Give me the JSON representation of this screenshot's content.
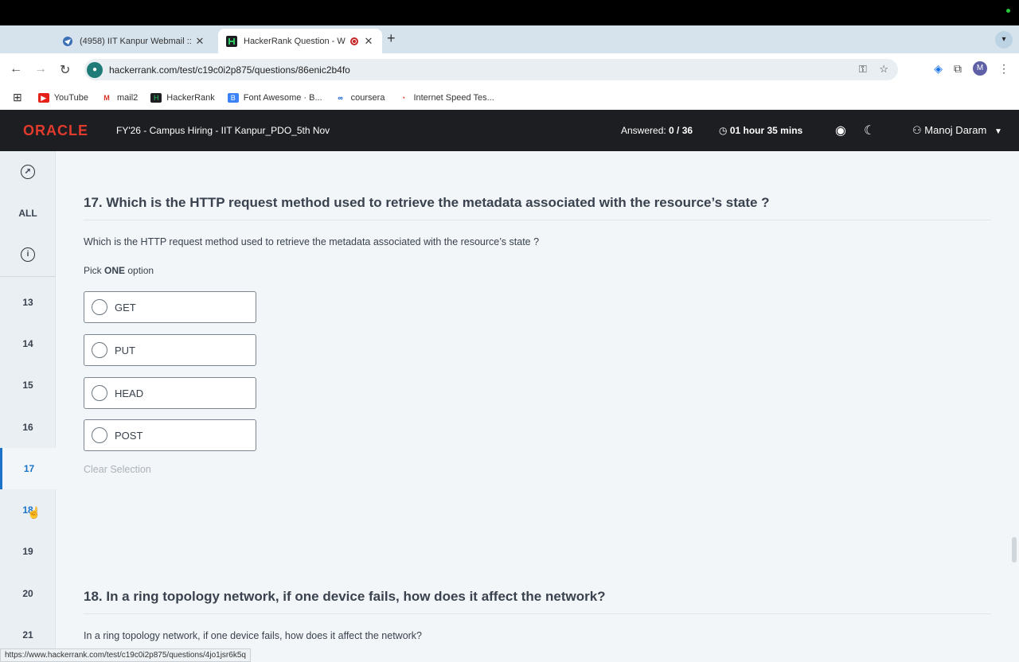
{
  "browser": {
    "tabs": [
      {
        "title": "(4958) IIT Kanpur Webmail ::",
        "active": false
      },
      {
        "title": "HackerRank Question - W",
        "active": true
      }
    ],
    "url": "hackerrank.com/test/c19c0i2p875/questions/86enic2b4fo",
    "status_url": "https://www.hackerrank.com/test/c19c0i2p875/questions/4jo1jsr6k5q",
    "profile_initial": "M",
    "bookmarks": [
      "YouTube",
      "mail2",
      "HackerRank",
      "Font Awesome · B...",
      "coursera",
      "Internet Speed Tes..."
    ]
  },
  "header": {
    "logo": "ORACLE",
    "test_title": "FY'26 - Campus Hiring - IIT Kanpur_PDO_5th Nov",
    "answered_label": "Answered:",
    "answered_value": "0 / 36",
    "timer": "01 hour 35 mins",
    "user": "Manoj Daram"
  },
  "rail": {
    "all_label": "ALL",
    "items": [
      "13",
      "14",
      "15",
      "16",
      "17",
      "18",
      "19",
      "20",
      "21"
    ],
    "active": "17"
  },
  "question17": {
    "title": "17. Which is the HTTP request method used to retrieve the metadata associated with the resource’s state ?",
    "body": "Which is the HTTP request method used to retrieve the metadata associated with the resource’s state ?",
    "pick_prefix": "Pick",
    "pick_bold": "ONE",
    "pick_suffix": "option",
    "options": [
      "GET",
      "PUT",
      "HEAD",
      "POST"
    ],
    "clear_label": "Clear Selection"
  },
  "question18": {
    "title": "18. In a ring topology network, if one device fails, how does it affect the network?",
    "body": "In a ring topology network, if one device fails, how does it affect the network?"
  }
}
